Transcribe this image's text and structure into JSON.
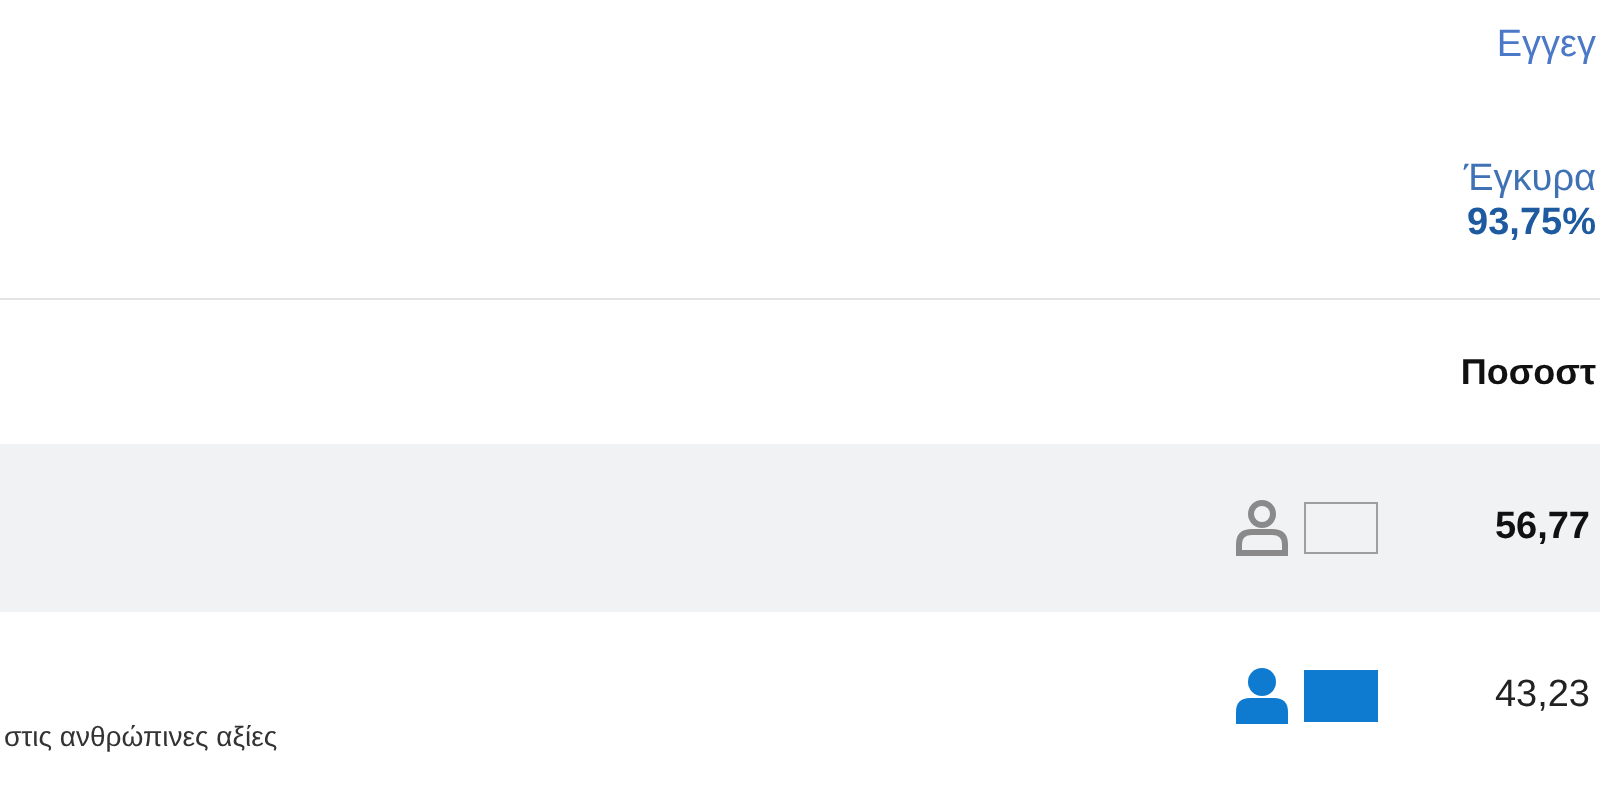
{
  "header": {
    "registered_label": "Εγγεγ",
    "valid_label": "Έγκυρα",
    "valid_percent": "93,75%"
  },
  "table": {
    "column_header": "Ποσοστ",
    "rows": [
      {
        "subtitle": "",
        "kind": "outline",
        "color": "#8a8a8a",
        "leading": true,
        "percent": "56,77"
      },
      {
        "subtitle": "στις ανθρώπινες αξίες",
        "kind": "filled",
        "color": "#0f7bd0",
        "leading": false,
        "percent": "43,23"
      }
    ]
  }
}
